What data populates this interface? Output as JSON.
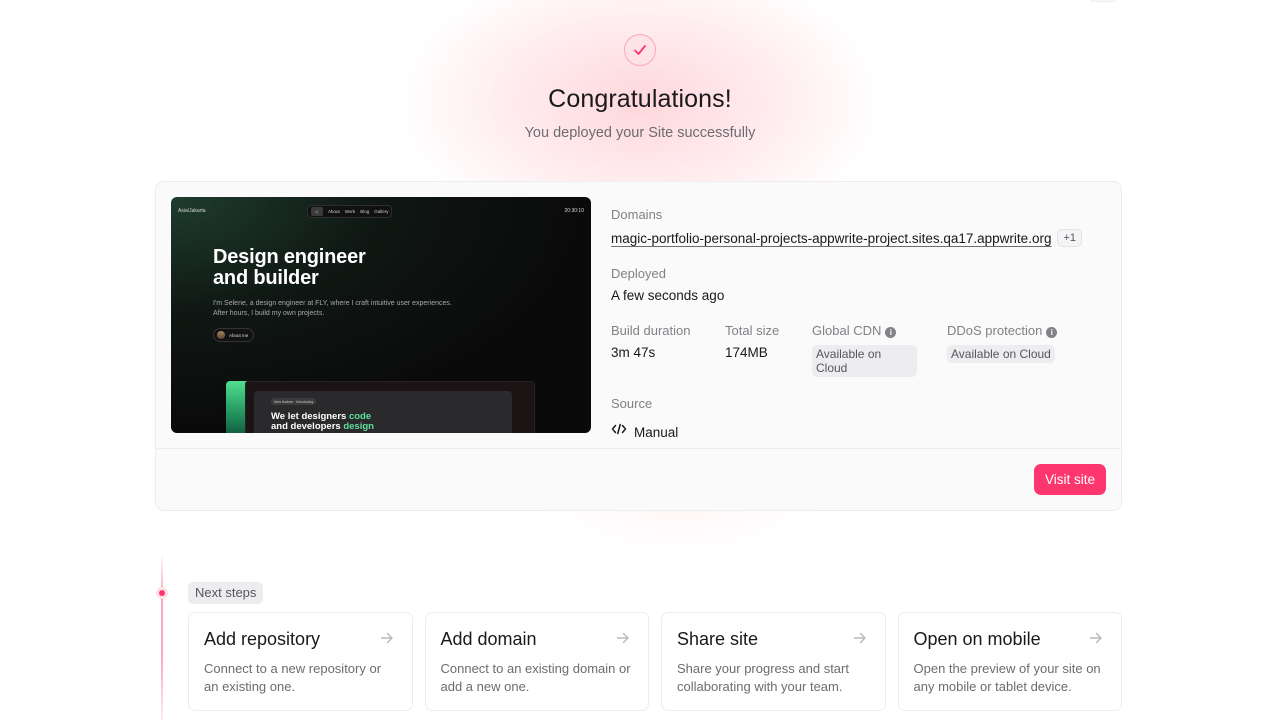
{
  "hero": {
    "title": "Congratulations!",
    "subtitle": "You deployed your Site successfully"
  },
  "preview": {
    "logo": "Asia/Jakarta",
    "time": "20:30:10",
    "nav": [
      "About",
      "Work",
      "Blog",
      "Gallery"
    ],
    "home_glyph": "⌂",
    "headline_line1": "Design engineer",
    "headline_line2": "and builder",
    "description": "I'm Selene, a design engineer at FLY, where I craft intuitive user experiences. After hours, I build my own projects.",
    "about_button": "About me",
    "pill": "New feature · Introducing",
    "big_text_line1_a": "We let designers ",
    "big_text_line1_b": "code",
    "big_text_line2_a": "and developers ",
    "big_text_line2_b": "design"
  },
  "deployment": {
    "domains_label": "Domains",
    "domain": "magic-portfolio-personal-projects-appwrite-project.sites.qa17.appwrite.org",
    "domain_extra": "+1",
    "deployed_label": "Deployed",
    "deployed_value": "A few seconds ago",
    "stats": [
      {
        "label": "Build duration",
        "value": "3m 47s"
      },
      {
        "label": "Total size",
        "value": "174MB"
      }
    ],
    "cdn_label": "Global CDN",
    "cdn_value": "Available on Cloud",
    "ddos_label": "DDoS protection",
    "ddos_value": "Available on Cloud",
    "source_label": "Source",
    "source_value": "Manual",
    "visit_button": "Visit site"
  },
  "next_steps": {
    "label": "Next steps",
    "cards": [
      {
        "title": "Add repository",
        "description": "Connect to a new repository or an existing one."
      },
      {
        "title": "Add domain",
        "description": "Connect to an existing domain or add a new one."
      },
      {
        "title": "Share site",
        "description": "Share your progress and start collaborating with your team."
      },
      {
        "title": "Open on mobile",
        "description": "Open the preview of your site on any mobile or tablet device."
      }
    ]
  },
  "colors": {
    "accent": "#fd366e",
    "accent_soft": "#fde2e6",
    "text_primary": "#19191c",
    "text_secondary": "#6c6c71",
    "border": "#ededf0"
  },
  "icons": {
    "success": "check-circle-icon",
    "info": "info-icon",
    "source": "code-icon",
    "step_arrow": "arrow-right-icon"
  }
}
